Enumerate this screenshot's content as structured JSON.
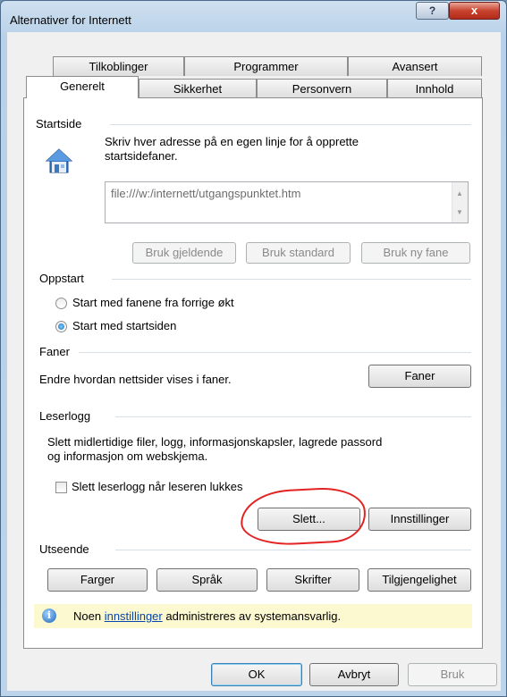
{
  "window": {
    "title": "Alternativer for Internett",
    "help_glyph": "?",
    "close_glyph": "x"
  },
  "tabs_row1": [
    "Tilkoblinger",
    "Programmer",
    "Avansert"
  ],
  "tabs_row2": [
    "Generelt",
    "Sikkerhet",
    "Personvern",
    "Innhold"
  ],
  "startside": {
    "group": "Startside",
    "instruction": "Skriv hver adresse på en egen linje for å opprette startsidefaner.",
    "url": "file:///w:/internett/utgangspunktet.htm",
    "btn_current": "Bruk gjeldende",
    "btn_default": "Bruk standard",
    "btn_newtab": "Bruk ny fane"
  },
  "oppstart": {
    "group": "Oppstart",
    "opt1": "Start med fanene fra forrige økt",
    "opt2": "Start med startsiden",
    "selected": 2
  },
  "faner": {
    "group": "Faner",
    "desc": "Endre hvordan nettsider vises i faner.",
    "button": "Faner"
  },
  "leserlogg": {
    "group": "Leserlogg",
    "desc1": "Slett midlertidige filer, logg, informasjonskapsler, lagrede passord",
    "desc2": "og informasjon om webskjema.",
    "checkbox": "Slett leserlogg når leseren lukkes",
    "checked": false,
    "btn_delete": "Slett...",
    "btn_settings": "Innstillinger"
  },
  "utseende": {
    "group": "Utseende",
    "btn_colors": "Farger",
    "btn_lang": "Språk",
    "btn_fonts": "Skrifter",
    "btn_access": "Tilgjengelighet"
  },
  "info": {
    "pre": "Noen ",
    "link": "innstillinger",
    "post": " administreres av systemansvarlig."
  },
  "footer": {
    "ok": "OK",
    "cancel": "Avbryt",
    "apply": "Bruk"
  },
  "colors": {
    "annotation": "#e32222",
    "link": "#0645ad"
  }
}
